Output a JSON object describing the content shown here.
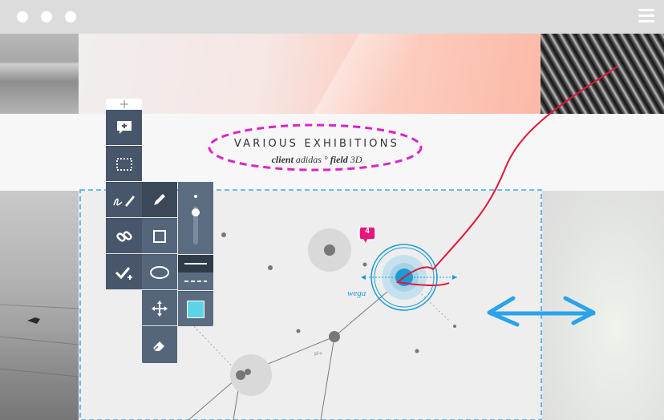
{
  "window": {
    "dots": 3,
    "menu_icon": "hamburger-icon"
  },
  "exhibition": {
    "title": "VARIOUS EXHIBITIONS",
    "client_label": "client",
    "client_name": "adidas",
    "degree": "°",
    "field_label": "field",
    "field_value": "3D"
  },
  "diagram": {
    "highlight_label": "wega",
    "small_label": "pl+"
  },
  "comment_badge": {
    "count": "4"
  },
  "toolbar": {
    "tools": [
      "drag-handle-icon",
      "add-comment-icon",
      "select-area-icon",
      "signature-pen-icon",
      "link-icon",
      "approve-icon"
    ],
    "shape_tools": [
      "pencil-icon",
      "rectangle-icon",
      "ellipse-icon",
      "move-icon",
      "eraser-icon"
    ],
    "line_styles": [
      "solid-line",
      "dashed-line"
    ],
    "fill_color": "#5fd3e6"
  },
  "colors": {
    "annotation_magenta": "#dd22c8",
    "annotation_red": "#e0173a",
    "selection_blue": "#3aa7e8",
    "arrow_blue": "#2aa3ea",
    "target_blue": "#1a9bd6",
    "badge_pink": "#e4197a"
  }
}
